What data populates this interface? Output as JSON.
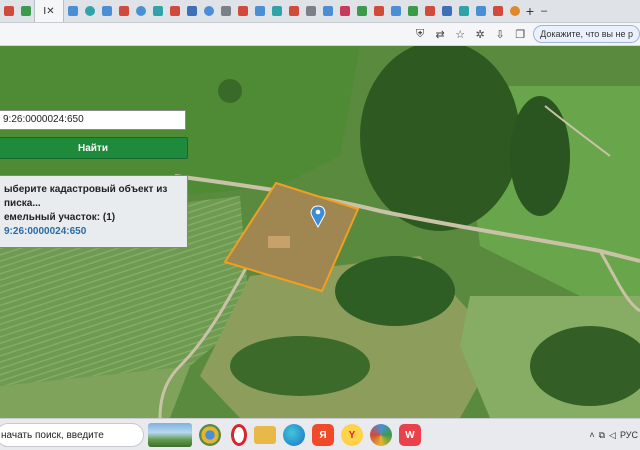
{
  "browser": {
    "active_tab": {
      "label": "I",
      "close": "✕"
    },
    "new_tab": "+",
    "proofread_label": "Докажите, что вы не р"
  },
  "map": {
    "search_value": "9:26:0000024:650",
    "find_label": "Найти",
    "result": {
      "line1": "ыберите кадастровый объект из",
      "line2": "писка...",
      "line3": "емельный участок: (1)",
      "cadastral": "9:26:0000024:650"
    }
  },
  "taskbar": {
    "search_text": "начать поиск, введите",
    "lang": "РУС"
  },
  "colors": {
    "find_button": "#1e8a3c",
    "parcel_outline": "#f0a020",
    "marker": "#3e8bd8",
    "cadastral_link": "#2a6aa4"
  },
  "icons": {
    "tab_favicons": [
      "red",
      "green",
      "grey",
      "blue",
      "teal",
      "blue",
      "red",
      "blue",
      "teal",
      "red",
      "blue",
      "blue",
      "grey",
      "red",
      "blue",
      "teal",
      "red",
      "grey",
      "blue",
      "red",
      "green",
      "red",
      "blue",
      "green",
      "red",
      "blue",
      "teal",
      "blue",
      "red",
      "orange"
    ],
    "taskbar_apps": [
      "chrome",
      "opera",
      "folder",
      "edge",
      "yandex-y",
      "yandex-browser",
      "chromium",
      "wps"
    ]
  }
}
